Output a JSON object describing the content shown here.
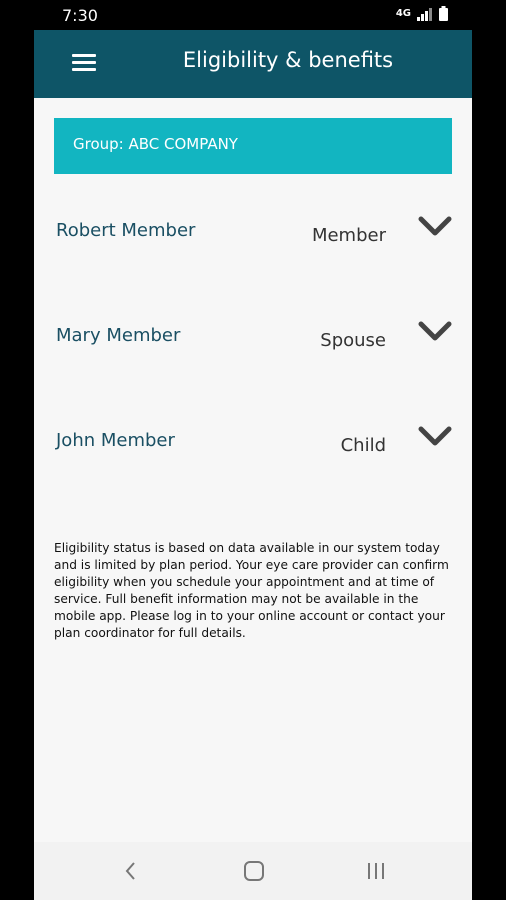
{
  "status_bar": {
    "time": "7:30",
    "network": "4G"
  },
  "header": {
    "title": "Eligibility & benefits"
  },
  "group": {
    "label": "Group: ABC COMPANY"
  },
  "members": [
    {
      "name": "Robert Member",
      "role": "Member"
    },
    {
      "name": "Mary Member",
      "role": "Spouse"
    },
    {
      "name": "John Member",
      "role": "Child"
    }
  ],
  "disclaimer": "Eligibility status is based on data available in our system today and is limited by plan period. Your eye care provider can confirm eligibility when you schedule your appointment and at time of service. Full benefit information may not be available in the mobile app. Please log in to your online account or contact your plan coordinator for full details.",
  "colors": {
    "app_bar": "#0e5567",
    "banner": "#12b5c1",
    "member_name": "#1a4f63"
  },
  "icons": [
    "menu-icon",
    "chevron-down-icon",
    "back-icon",
    "home-icon",
    "recent-apps-icon"
  ]
}
